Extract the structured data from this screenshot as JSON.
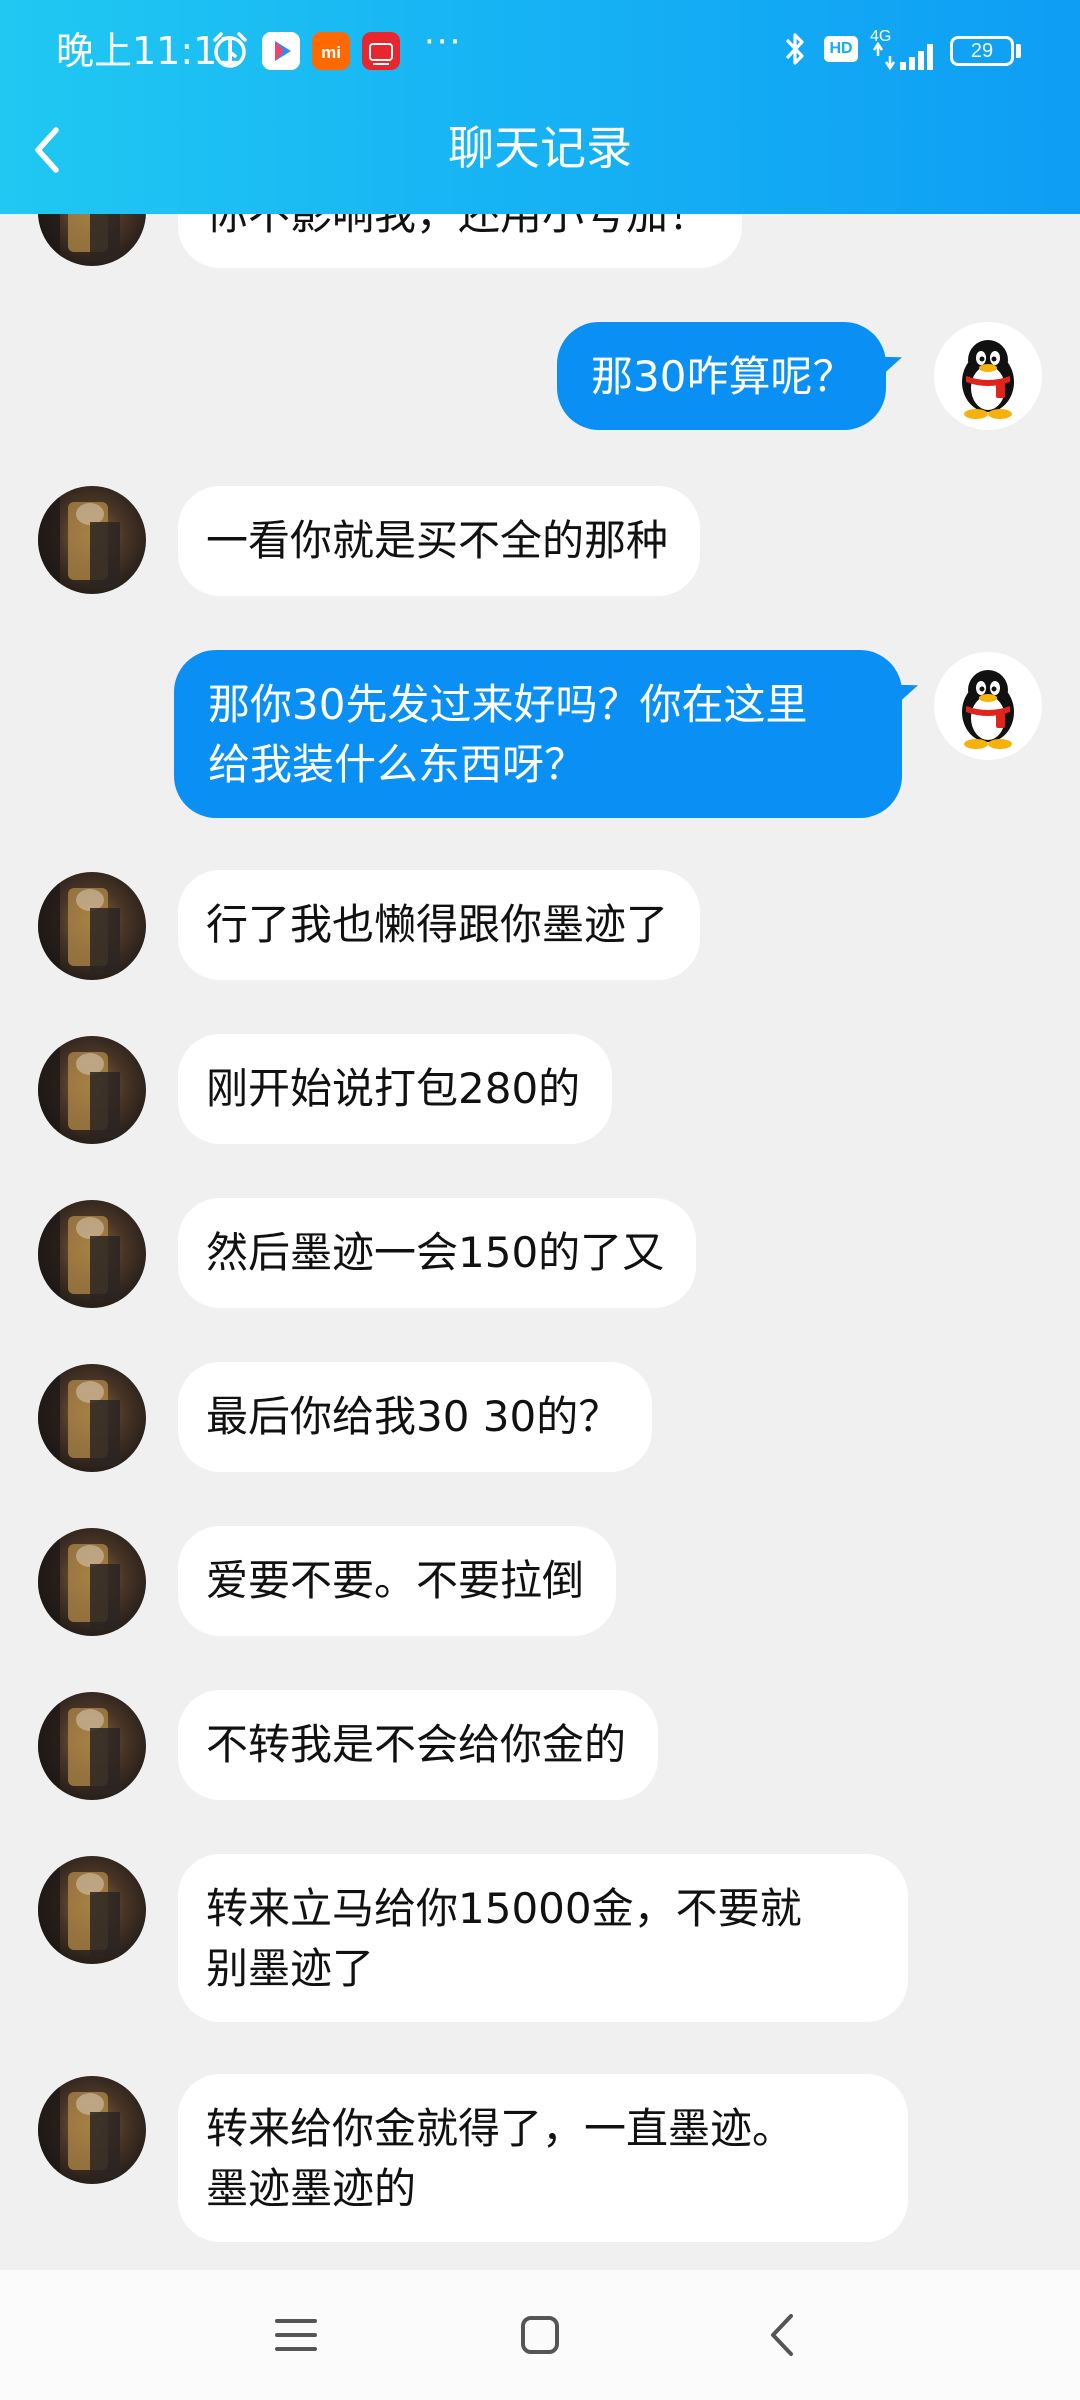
{
  "status_bar": {
    "time": "晚上11:11",
    "more": "···",
    "network": "4G",
    "battery": "29",
    "icons": [
      "alarm-icon",
      "video-app-icon",
      "mi-app-icon",
      "store-app-icon",
      "bluetooth-icon",
      "hd-icon",
      "signal-icon",
      "battery-icon"
    ],
    "hd": "HD"
  },
  "header": {
    "title": "聊天记录",
    "back_icon": "chevron-left-icon"
  },
  "colors": {
    "header_start": "#20c8f2",
    "header_end": "#0e9ef4",
    "outgoing_bubble": "#0a8ff5",
    "incoming_bubble": "#ffffff",
    "background": "#f0f0f0"
  },
  "messages": [
    {
      "side": "in",
      "text": "你不影响我，还用小号加！"
    },
    {
      "side": "out",
      "text": "那30咋算呢？"
    },
    {
      "side": "in",
      "text": "一看你就是买不全的那种"
    },
    {
      "side": "out",
      "text": "那你30先发过来好吗？你在这里\n给我装什么东西呀？"
    },
    {
      "side": "in",
      "text": "行了我也懒得跟你墨迹了"
    },
    {
      "side": "in",
      "text": "刚开始说打包280的"
    },
    {
      "side": "in",
      "text": "然后墨迹一会150的了又"
    },
    {
      "side": "in",
      "text": "最后你给我30 30的？"
    },
    {
      "side": "in",
      "text": "爱要不要。不要拉倒"
    },
    {
      "side": "in",
      "text": "不转我是不会给你金的"
    },
    {
      "side": "in",
      "text": "转来立马给你15000金，不要就\n别墨迹了"
    },
    {
      "side": "in",
      "text": "转来给你金就得了，一直墨迹。\n墨迹墨迹的"
    }
  ],
  "nav": {
    "icons": [
      "menu-icon",
      "home-icon",
      "back-icon"
    ]
  }
}
